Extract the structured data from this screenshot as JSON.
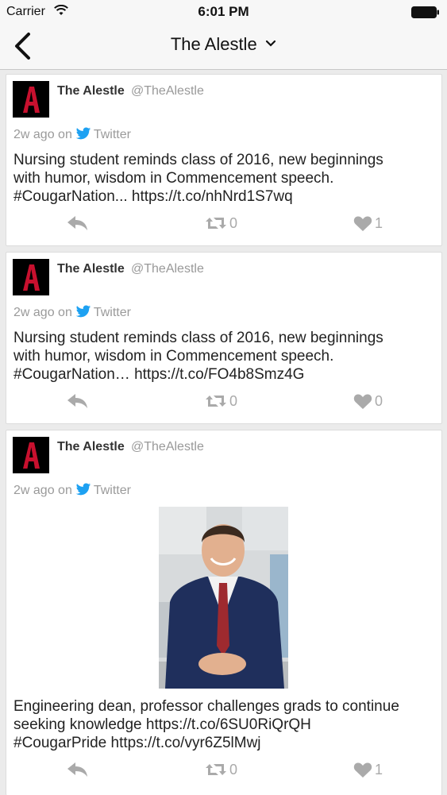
{
  "status": {
    "carrier": "Carrier",
    "time": "6:01 PM"
  },
  "nav": {
    "title": "The Alestle"
  },
  "tweets": [
    {
      "name": "The Alestle",
      "handle": "@TheAlestle",
      "time": "2w ago on",
      "source": "Twitter",
      "text_lines": [
        "Nursing student reminds class of 2016, new beginnings",
        "with humor, wisdom in Commencement speech.",
        "#CougarNation... https://t.co/nhNrd1S7wq"
      ],
      "retweets": "0",
      "likes": "1"
    },
    {
      "name": "The Alestle",
      "handle": "@TheAlestle",
      "time": "2w ago on",
      "source": "Twitter",
      "text_lines": [
        "Nursing student reminds class of 2016, new beginnings",
        "with humor, wisdom in Commencement speech.",
        "#CougarNation… https://t.co/FO4b8Smz4G"
      ],
      "retweets": "0",
      "likes": "0"
    },
    {
      "name": "The Alestle",
      "handle": "@TheAlestle",
      "time": "2w ago on",
      "source": "Twitter",
      "text_lines": [
        "Engineering dean, professor challenges grads to continue",
        "seeking knowledge https://t.co/6SU0RiQrQH",
        "#CougarPride https://t.co/vyr6Z5lMwj"
      ],
      "retweets": "0",
      "likes": "1"
    }
  ],
  "icons": {
    "back": "chevron-left-icon",
    "title_menu": "chevron-down-icon",
    "reply": "reply-icon",
    "retweet": "retweet-icon",
    "like": "heart-icon",
    "source": "twitter-bird-icon"
  },
  "colors": {
    "twitter_blue": "#1da1f2",
    "logo_red": "#c8102e",
    "action_gray": "#aaaaaa"
  }
}
